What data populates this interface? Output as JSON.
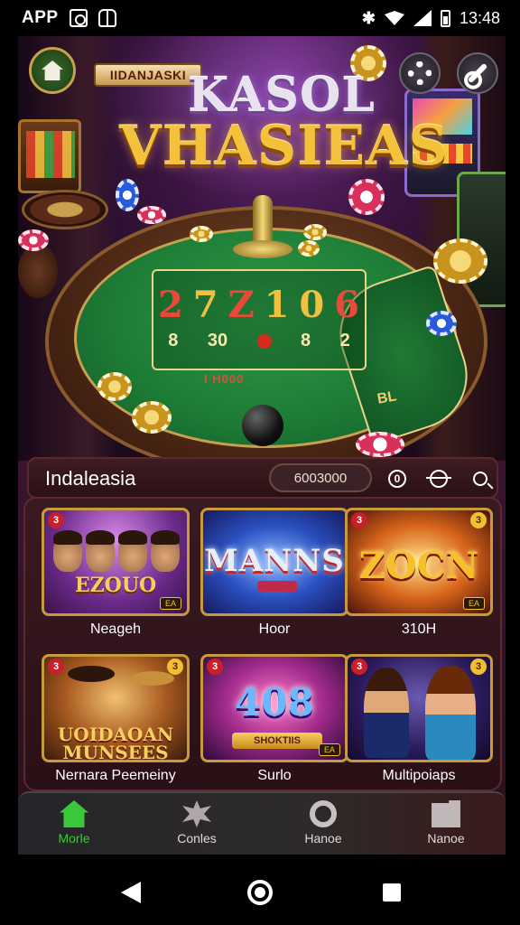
{
  "status_bar": {
    "app_label": "APP",
    "time": "13:48"
  },
  "hero": {
    "title_tag": "IIDANJASKI",
    "title_line1": "KASOL",
    "title_line2": "VHASIEAS",
    "table_numbers": [
      "2",
      "7",
      "Z",
      "1",
      "0",
      "6"
    ],
    "table_row2": [
      "8",
      "30",
      "",
      "8",
      "2"
    ],
    "table_label": "I   H000",
    "side_zone_text": "BL"
  },
  "header": {
    "title": "Indaleasia",
    "balance": "6003000",
    "coin_glyph": "0"
  },
  "games": [
    {
      "name": "Neageh",
      "logo": "EZOUO",
      "badge": "3",
      "corner": "",
      "tag": "EA"
    },
    {
      "name": "Hoor",
      "logo": "MANNS",
      "badge": "",
      "corner": "",
      "tag": ""
    },
    {
      "name": "310H",
      "logo": "ZOCN",
      "badge": "3",
      "corner": "3",
      "tag": "EA"
    },
    {
      "name": "Nernara Peemeiny",
      "logo": "UOIDAOAN MUNSEES",
      "badge": "3",
      "corner": "3",
      "tag": ""
    },
    {
      "name": "Surlo",
      "logo": "408",
      "badge": "3",
      "corner": "",
      "tag": "EA",
      "spin_label": "SHOKTIIS"
    },
    {
      "name": "Multipoiaps",
      "logo": "",
      "badge": "3",
      "corner": "3",
      "tag": ""
    }
  ],
  "bottom_nav": [
    {
      "label": "Morle",
      "icon": "home-icon",
      "active": true
    },
    {
      "label": "Conles",
      "icon": "games-icon",
      "active": false
    },
    {
      "label": "Hanoe",
      "icon": "circle-icon",
      "active": false
    },
    {
      "label": "Nanoe",
      "icon": "folder-icon",
      "active": false
    }
  ],
  "colors": {
    "accent_active": "#3ac83a",
    "gold": "#f4c23a",
    "card_border": "#c89a3a"
  }
}
